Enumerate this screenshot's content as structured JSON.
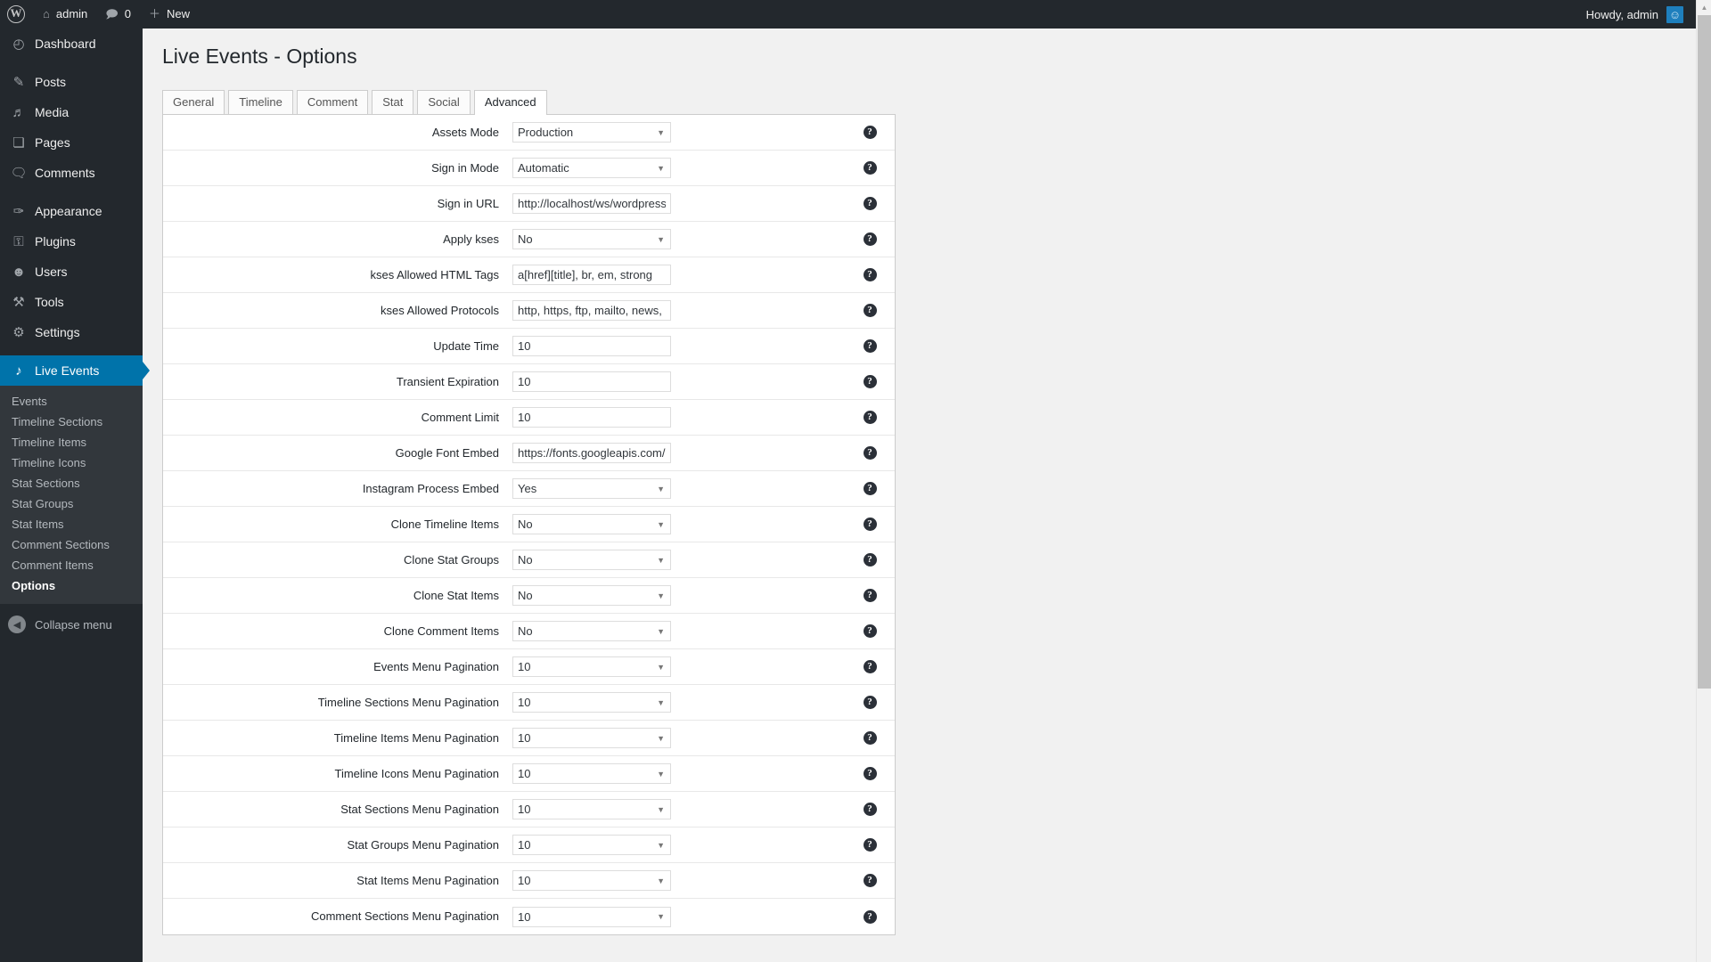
{
  "adminbar": {
    "wp_logo": "wordpress-logo",
    "site_name": "admin",
    "comments_count": "0",
    "new_label": "New",
    "howdy": "Howdy, admin"
  },
  "sidebar": {
    "items": [
      {
        "label": "Dashboard",
        "icon": "dashboard-icon",
        "glyph": "◴"
      },
      {
        "label": "Posts",
        "icon": "pin-icon",
        "glyph": "✎"
      },
      {
        "label": "Media",
        "icon": "media-icon",
        "glyph": "♬"
      },
      {
        "label": "Pages",
        "icon": "pages-icon",
        "glyph": "❏"
      },
      {
        "label": "Comments",
        "icon": "comments-icon",
        "glyph": "🗨"
      },
      {
        "label": "Appearance",
        "icon": "brush-icon",
        "glyph": "✑"
      },
      {
        "label": "Plugins",
        "icon": "plug-icon",
        "glyph": "⚿"
      },
      {
        "label": "Users",
        "icon": "user-icon",
        "glyph": "☻"
      },
      {
        "label": "Tools",
        "icon": "wrench-icon",
        "glyph": "⚒"
      },
      {
        "label": "Settings",
        "icon": "sliders-icon",
        "glyph": "⚙"
      },
      {
        "label": "Live Events",
        "icon": "microphone-icon",
        "glyph": "♪"
      }
    ],
    "submenu": [
      "Events",
      "Timeline Sections",
      "Timeline Items",
      "Timeline Icons",
      "Stat Sections",
      "Stat Groups",
      "Stat Items",
      "Comment Sections",
      "Comment Items",
      "Options"
    ],
    "active_submenu": "Options",
    "collapse_label": "Collapse menu"
  },
  "page": {
    "title": "Live Events - Options"
  },
  "tabs": [
    {
      "label": "General",
      "active": false
    },
    {
      "label": "Timeline",
      "active": false
    },
    {
      "label": "Comment",
      "active": false
    },
    {
      "label": "Stat",
      "active": false
    },
    {
      "label": "Social",
      "active": false
    },
    {
      "label": "Advanced",
      "active": true
    }
  ],
  "help_glyph": "?",
  "form_rows": [
    {
      "label": "Assets Mode",
      "type": "select",
      "value": "Production"
    },
    {
      "label": "Sign in Mode",
      "type": "select",
      "value": "Automatic"
    },
    {
      "label": "Sign in URL",
      "type": "text",
      "value": "http://localhost/ws/wordpress/wp-logi"
    },
    {
      "label": "Apply kses",
      "type": "select",
      "value": "No"
    },
    {
      "label": "kses Allowed HTML Tags",
      "type": "text",
      "value": "a[href][title], br, em, strong"
    },
    {
      "label": "kses Allowed Protocols",
      "type": "text",
      "value": "http, https, ftp, mailto, news, irc, gophe"
    },
    {
      "label": "Update Time",
      "type": "text",
      "value": "10"
    },
    {
      "label": "Transient Expiration",
      "type": "text",
      "value": "10"
    },
    {
      "label": "Comment Limit",
      "type": "text",
      "value": "10"
    },
    {
      "label": "Google Font Embed",
      "type": "text",
      "value": "https://fonts.googleapis.com/css?famil"
    },
    {
      "label": "Instagram Process Embed",
      "type": "select",
      "value": "Yes"
    },
    {
      "label": "Clone Timeline Items",
      "type": "select",
      "value": "No"
    },
    {
      "label": "Clone Stat Groups",
      "type": "select",
      "value": "No"
    },
    {
      "label": "Clone Stat Items",
      "type": "select",
      "value": "No"
    },
    {
      "label": "Clone Comment Items",
      "type": "select",
      "value": "No"
    },
    {
      "label": "Events Menu Pagination",
      "type": "select",
      "value": "10"
    },
    {
      "label": "Timeline Sections Menu Pagination",
      "type": "select",
      "value": "10"
    },
    {
      "label": "Timeline Items Menu Pagination",
      "type": "select",
      "value": "10"
    },
    {
      "label": "Timeline Icons Menu Pagination",
      "type": "select",
      "value": "10"
    },
    {
      "label": "Stat Sections Menu Pagination",
      "type": "select",
      "value": "10"
    },
    {
      "label": "Stat Groups Menu Pagination",
      "type": "select",
      "value": "10"
    },
    {
      "label": "Stat Items Menu Pagination",
      "type": "select",
      "value": "10"
    },
    {
      "label": "Comment Sections Menu Pagination",
      "type": "select",
      "value": "10"
    }
  ],
  "colors": {
    "admin_dark": "#23282d",
    "submenu_bg": "#32373c",
    "accent_blue": "#0073aa",
    "content_bg": "#f1f1f1"
  }
}
